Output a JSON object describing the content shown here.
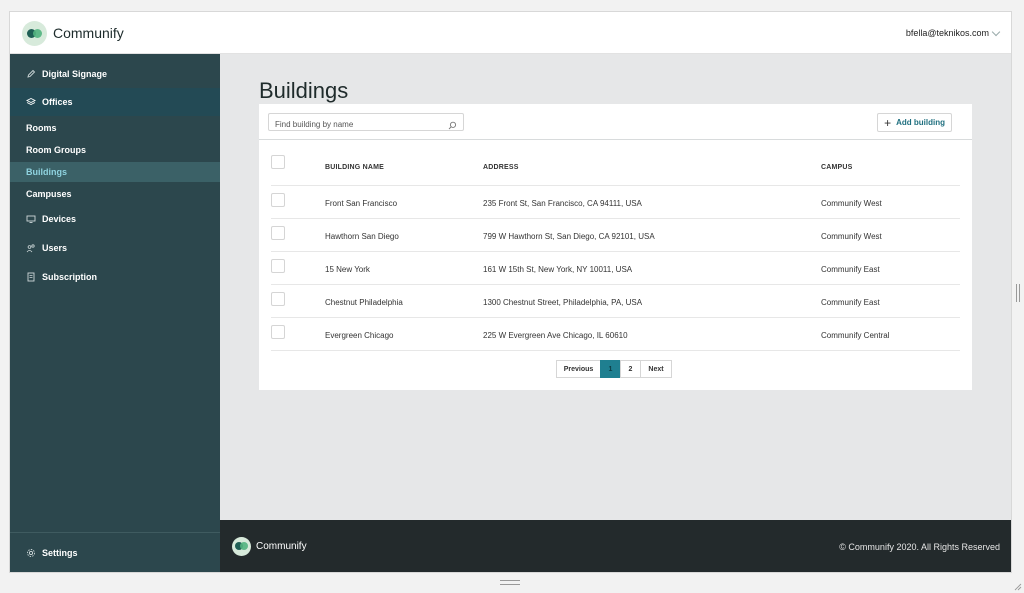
{
  "app": {
    "name": "Communify",
    "user_email": "bfella@teknikos.com"
  },
  "sidebar": {
    "items": [
      {
        "label": "Digital Signage",
        "icon": "pencil-icon"
      },
      {
        "label": "Offices",
        "icon": "layers-icon"
      },
      {
        "label": "Devices",
        "icon": "monitor-icon"
      },
      {
        "label": "Users",
        "icon": "users-icon"
      },
      {
        "label": "Subscription",
        "icon": "receipt-icon"
      }
    ],
    "sub_items": [
      "Rooms",
      "Room Groups",
      "Buildings",
      "Campuses"
    ],
    "settings_label": "Settings"
  },
  "page": {
    "title": "Buildings",
    "search_placeholder": "Find building by name",
    "add_button_label": "Add building"
  },
  "table": {
    "columns": [
      "BUILDING NAME",
      "ADDRESS",
      "CAMPUS"
    ],
    "rows": [
      {
        "name": "Front San Francisco",
        "address": "235 Front St, San Francisco, CA 94111, USA",
        "campus": "Communify West"
      },
      {
        "name": "Hawthorn San Diego",
        "address": "799 W Hawthorn St, San Diego, CA 92101, USA",
        "campus": "Communify West"
      },
      {
        "name": "15 New York",
        "address": "161 W 15th St, New York, NY 10011, USA",
        "campus": "Communify East"
      },
      {
        "name": "Chestnut Philadelphia",
        "address": "1300 Chestnut Street, Philadelphia, PA, USA",
        "campus": "Communify East"
      },
      {
        "name": "Evergreen Chicago",
        "address": "225 W Evergreen Ave Chicago, IL 60610",
        "campus": "Communify Central"
      }
    ]
  },
  "pagination": {
    "previous": "Previous",
    "pages": [
      "1",
      "2"
    ],
    "current": "1",
    "next": "Next"
  },
  "footer": {
    "brand": "Communify",
    "copyright": "© Communify 2020. All Rights Reserved"
  },
  "colors": {
    "sidebar": "#2c474d",
    "accent": "#1f7f90",
    "footer": "#232a2c",
    "active_link": "#8fd3e0"
  }
}
